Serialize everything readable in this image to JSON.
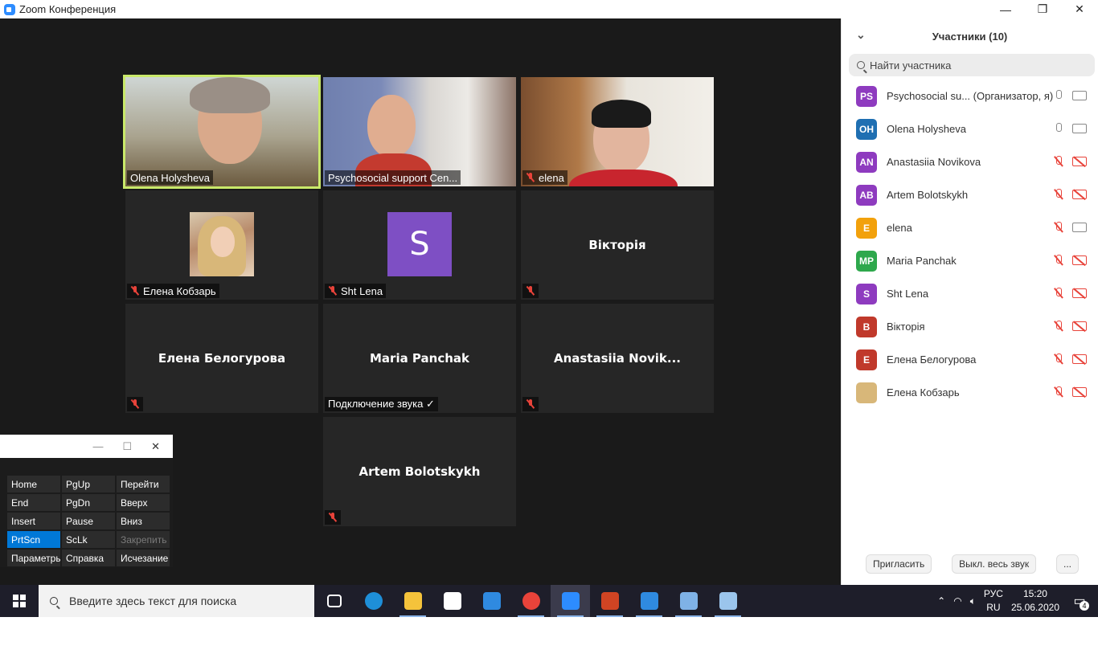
{
  "window": {
    "title": "Zoom Конференция"
  },
  "window_controls": {
    "minimize": "—",
    "maximize": "❐",
    "close": "✕"
  },
  "gallery": {
    "tiles": [
      {
        "name": "Olena Holysheva",
        "kind": "video",
        "muted": false,
        "active": true
      },
      {
        "name": "Psychosocial support Cen...",
        "kind": "video",
        "muted": false,
        "active": false
      },
      {
        "name": "elena",
        "kind": "video",
        "muted": true,
        "active": false
      },
      {
        "name": "Елена Кобзарь",
        "kind": "photo",
        "muted": true,
        "active": false
      },
      {
        "name": "Sht Lena",
        "kind": "letter",
        "letter": "S",
        "muted": true,
        "active": false
      },
      {
        "name": "Вікторія",
        "kind": "center",
        "muted": true,
        "active": false
      },
      {
        "name": "Елена Белогурова",
        "kind": "center",
        "muted": true,
        "active": false
      },
      {
        "name": "Maria Panchak",
        "kind": "center",
        "muted": false,
        "status": "Подключение звука ✓",
        "active": false
      },
      {
        "name": "Anastasiia  Novik...",
        "kind": "center",
        "muted": true,
        "active": false
      },
      {
        "name": "Artem Bolotskykh",
        "kind": "center",
        "muted": true,
        "active": false
      }
    ]
  },
  "participants_panel": {
    "title": "Участники (10)",
    "search_placeholder": "Найти участника",
    "participants": [
      {
        "initials": "PS",
        "name": "Psychosocial su... (Организатор, я)",
        "color": "#8e3bbf",
        "mic_off": false,
        "cam_off": false
      },
      {
        "initials": "OH",
        "name": "Olena Holysheva",
        "color": "#1f6fb2",
        "mic_off": false,
        "cam_off": false
      },
      {
        "initials": "AN",
        "name": "Anastasiia Novikova",
        "color": "#8e3bbf",
        "mic_off": true,
        "cam_off": true
      },
      {
        "initials": "AB",
        "name": "Artem Bolotskykh",
        "color": "#8e3bbf",
        "mic_off": true,
        "cam_off": true
      },
      {
        "initials": "E",
        "name": "elena",
        "color": "#f2a10c",
        "mic_off": true,
        "cam_off": false
      },
      {
        "initials": "MP",
        "name": "Maria Panchak",
        "color": "#2ea84c",
        "mic_off": true,
        "cam_off": true
      },
      {
        "initials": "S",
        "name": "Sht Lena",
        "color": "#8e3bbf",
        "mic_off": true,
        "cam_off": true
      },
      {
        "initials": "B",
        "name": "Вікторія",
        "color": "#c0392b",
        "mic_off": true,
        "cam_off": true
      },
      {
        "initials": "E",
        "name": "Елена Белогурова",
        "color": "#c0392b",
        "mic_off": true,
        "cam_off": true
      },
      {
        "initials": "",
        "name": "Елена Кобзарь",
        "color": "#d8b779",
        "mic_off": true,
        "cam_off": true
      }
    ],
    "footer": {
      "invite": "Пригласить",
      "mute_all": "Выкл. весь звук",
      "more": "..."
    }
  },
  "onscreen_keyboard": {
    "title_controls": [
      "—",
      "☐",
      "✕"
    ],
    "keys": [
      {
        "label": "Home",
        "state": "normal"
      },
      {
        "label": "PgUp",
        "state": "normal"
      },
      {
        "label": "Перейти",
        "state": "normal"
      },
      {
        "label": "End",
        "state": "normal"
      },
      {
        "label": "PgDn",
        "state": "normal"
      },
      {
        "label": "Вверх",
        "state": "normal"
      },
      {
        "label": "Insert",
        "state": "normal"
      },
      {
        "label": "Pause",
        "state": "normal"
      },
      {
        "label": "Вниз",
        "state": "normal"
      },
      {
        "label": "PrtScn",
        "state": "highlighted"
      },
      {
        "label": "ScLk",
        "state": "normal"
      },
      {
        "label": "Закрепить",
        "state": "disabled"
      },
      {
        "label": "Параметры",
        "state": "normal"
      },
      {
        "label": "Справка",
        "state": "normal"
      },
      {
        "label": "Исчезание",
        "state": "normal"
      }
    ]
  },
  "taskbar": {
    "search_placeholder": "Введите здесь текст для поиска",
    "apps": [
      {
        "name": "task-view-icon",
        "color": "#ffffff"
      },
      {
        "name": "edge-icon",
        "color": "#1e8fd8"
      },
      {
        "name": "file-explorer-icon",
        "color": "#f5c33b"
      },
      {
        "name": "store-icon",
        "color": "#ffffff"
      },
      {
        "name": "mail-icon",
        "color": "#2f8ae0"
      },
      {
        "name": "chrome-icon",
        "color": "#e8433a"
      },
      {
        "name": "zoom-icon",
        "color": "#2d8cff"
      },
      {
        "name": "powerpoint-icon",
        "color": "#d04423"
      },
      {
        "name": "movie-maker-icon",
        "color": "#2f8ae0"
      },
      {
        "name": "keyboard-app-icon",
        "color": "#7fb2e6"
      },
      {
        "name": "paint-icon",
        "color": "#9bc5ec"
      }
    ],
    "tray": {
      "lang_top": "РУС",
      "lang_bottom": "RU",
      "time": "15:20",
      "date": "25.06.2020",
      "notifications": "4"
    }
  }
}
